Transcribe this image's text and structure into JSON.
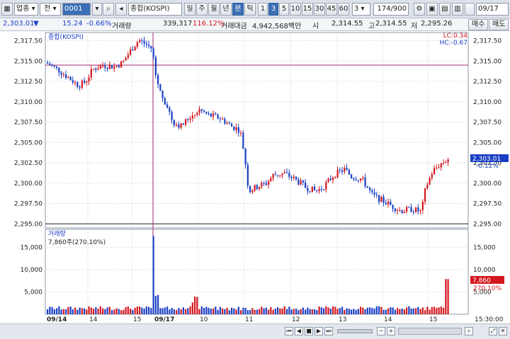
{
  "toolbar": {
    "market": "업종",
    "period_type": "전",
    "code": "0001",
    "name": "종합(KOSPI)",
    "tabs": [
      "일",
      "주",
      "월",
      "년",
      "분",
      "틱"
    ],
    "active_tab": "분",
    "intervals": [
      "1",
      "3",
      "5",
      "10",
      "15",
      "30",
      "45",
      "60"
    ],
    "active_interval": "3",
    "interval_select": "3",
    "count": "174/900",
    "date": "09/17"
  },
  "info": {
    "price": "2,303.01",
    "change_arrow": "▼",
    "change": "15.24",
    "change_pct": "-0.66%",
    "volume_label": "거래량",
    "volume": "339,317",
    "volume_ratio": "116.12%",
    "amount_label": "거래대금",
    "amount": "4,942,568백만",
    "open_label": "시",
    "open": "2,314.55",
    "high_label": "고",
    "high": "2,314.55",
    "low_label": "저",
    "low": "2,295.26",
    "sell_label": "매수",
    "buy_label": "매도"
  },
  "price_panel": {
    "legend": "종합(KOSPI)",
    "lc": "LC:0.34",
    "hc": "HC:-0.67",
    "y_ticks": [
      "2,317.50",
      "2,315.00",
      "2,312.50",
      "2,310.00",
      "2,307.50",
      "2,305.00",
      "2,302.50",
      "2,300.00",
      "2,297.50",
      "2,295.00"
    ],
    "current_value": "2,303.01",
    "current_pct": "-0.12%"
  },
  "volume_panel": {
    "legend": "거래량",
    "current": "7,860주(270.10%)",
    "y_ticks": [
      "15,000",
      "10,000",
      "5,000"
    ],
    "current_tag": "7,860",
    "current_tag_pct": "270.10%"
  },
  "x_axis": {
    "labels": [
      "09/14",
      "14",
      "15",
      "09/17",
      "10",
      "11",
      "12",
      "13",
      "14",
      "15"
    ],
    "time": "15:30:00"
  },
  "colors": {
    "up": "#d4171f",
    "down": "#1a3fc4",
    "grid": "#c9ced8"
  },
  "chart_data": {
    "type": "candlestick",
    "ylim": [
      2294.5,
      2318.5
    ],
    "candles": [],
    "reference_lines": [
      2314.5,
      2295.0
    ],
    "volume_ylim": [
      0,
      19000
    ]
  }
}
